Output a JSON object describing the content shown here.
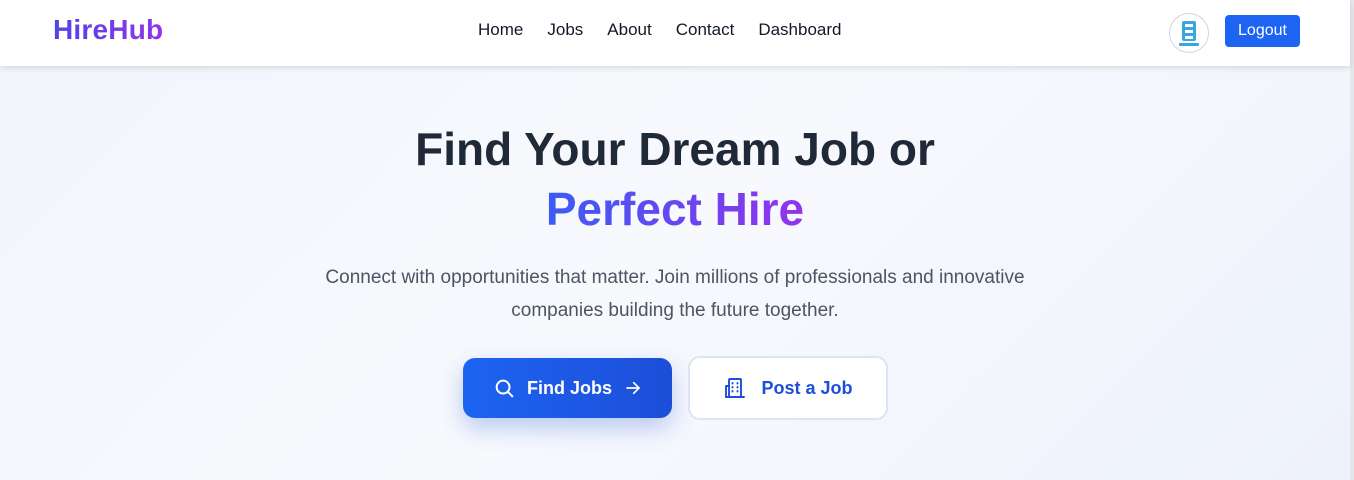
{
  "brand": "HireHub",
  "nav": {
    "links": [
      {
        "label": "Home"
      },
      {
        "label": "Jobs"
      },
      {
        "label": "About"
      },
      {
        "label": "Contact"
      },
      {
        "label": "Dashboard"
      }
    ],
    "logout_label": "Logout"
  },
  "hero": {
    "title": "Find Your Dream Job or",
    "accent": "Perfect Hire",
    "subtitle_line1": "Connect with opportunities that matter. Join millions of professionals and innovative",
    "subtitle_line2": "companies building the future together.",
    "primary_cta": "Find Jobs",
    "secondary_cta": "Post a Job"
  },
  "icons": {
    "avatar": "user-avatar-logo",
    "primary_cta_left": "search-icon",
    "primary_cta_right": "arrow-right-icon",
    "secondary_cta": "building-icon"
  },
  "colors": {
    "primary": "#1d64f2",
    "brand_gradient_start": "#4f46e5",
    "brand_gradient_end": "#9333ea",
    "text_dark": "#1f2937",
    "text_muted": "#4b5563"
  }
}
